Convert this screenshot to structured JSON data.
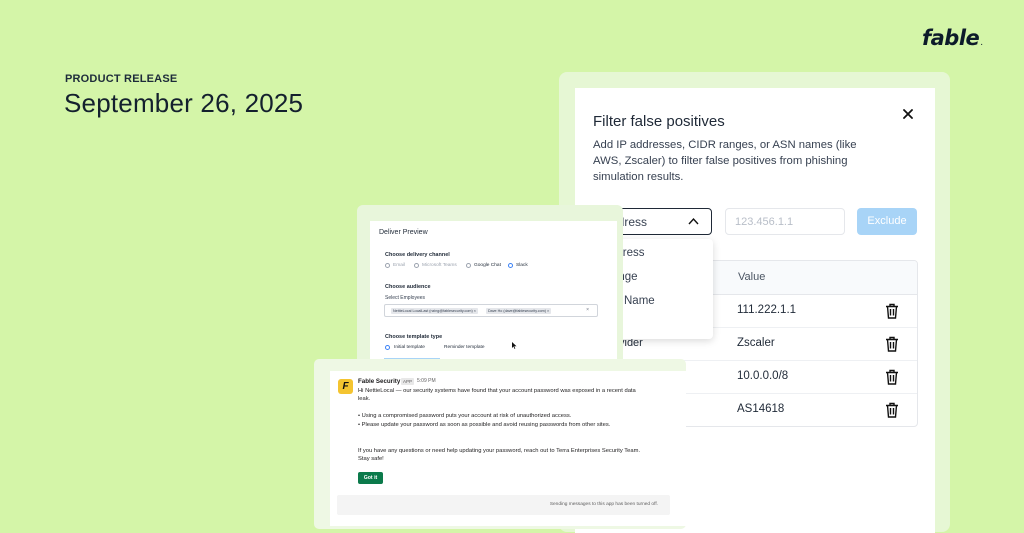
{
  "brand": {
    "logo_text": "fable",
    "logo_mark": "."
  },
  "hero": {
    "eyebrow": "PRODUCT RELEASE",
    "date": "September 26, 2025"
  },
  "modal": {
    "title": "Filter false positives",
    "close_icon": "close-icon",
    "description": "Add IP addresses, CIDR ranges, or ASN names (like AWS, Zscaler) to filter false positives from phishing simulation results.",
    "type_select_value": "ddress",
    "value_placeholder": "123.456.1.1",
    "exclude_label": "Exclude",
    "exclude_color": "#a8d4f7",
    "dropdown_options": [
      "ddress",
      "ange",
      "Name"
    ],
    "table": {
      "header_value": "Value",
      "rows": [
        {
          "type": "",
          "value": "111.222.1.1"
        },
        {
          "type": "vider",
          "value": "Zscaler"
        },
        {
          "type": "",
          "value": "10.0.0.0/8"
        },
        {
          "type": "",
          "value": "AS14618"
        }
      ],
      "row_icon": "trash-icon"
    }
  },
  "preview": {
    "title": "Deliver Preview",
    "delivery_label": "Choose delivery channel",
    "channels": [
      "Email",
      "Microsoft Teams",
      "Google Chat",
      "Slack"
    ],
    "selected_channel": "Slack",
    "audience_label": "Choose audience",
    "employees_label": "Select Employees",
    "employees": [
      "NettieLocal LocalLast (nzing@fablesecurity.com)",
      "Dave Ho (dave@fablesecurity.com)"
    ],
    "template_label": "Choose template type",
    "templates": [
      "Initial template",
      "Reminder template"
    ],
    "selected_template": "Initial template"
  },
  "slack": {
    "avatar_letter": "F",
    "sender": "Fable Security",
    "badge": "APP",
    "time": "5:09 PM",
    "greeting": "Hi NettieLocal — our security systems have found that your account password was exposed in a recent data leak.",
    "bullets": [
      "• Using a compromised password puts your account at risk of unauthorized access.",
      "• Please update your password as soon as possible and avoid reusing passwords from other sites."
    ],
    "closing": "If you have any questions or need help updating your password, reach out to Terra Enterprises Security Team. Stay safe!",
    "button_label": "Got it",
    "button_color": "#0b7a4b",
    "footer_text": "Sending messages to this app has been turned off."
  },
  "colors": {
    "background": "#d4f5a8",
    "radio_selected": "#3b82f6"
  }
}
